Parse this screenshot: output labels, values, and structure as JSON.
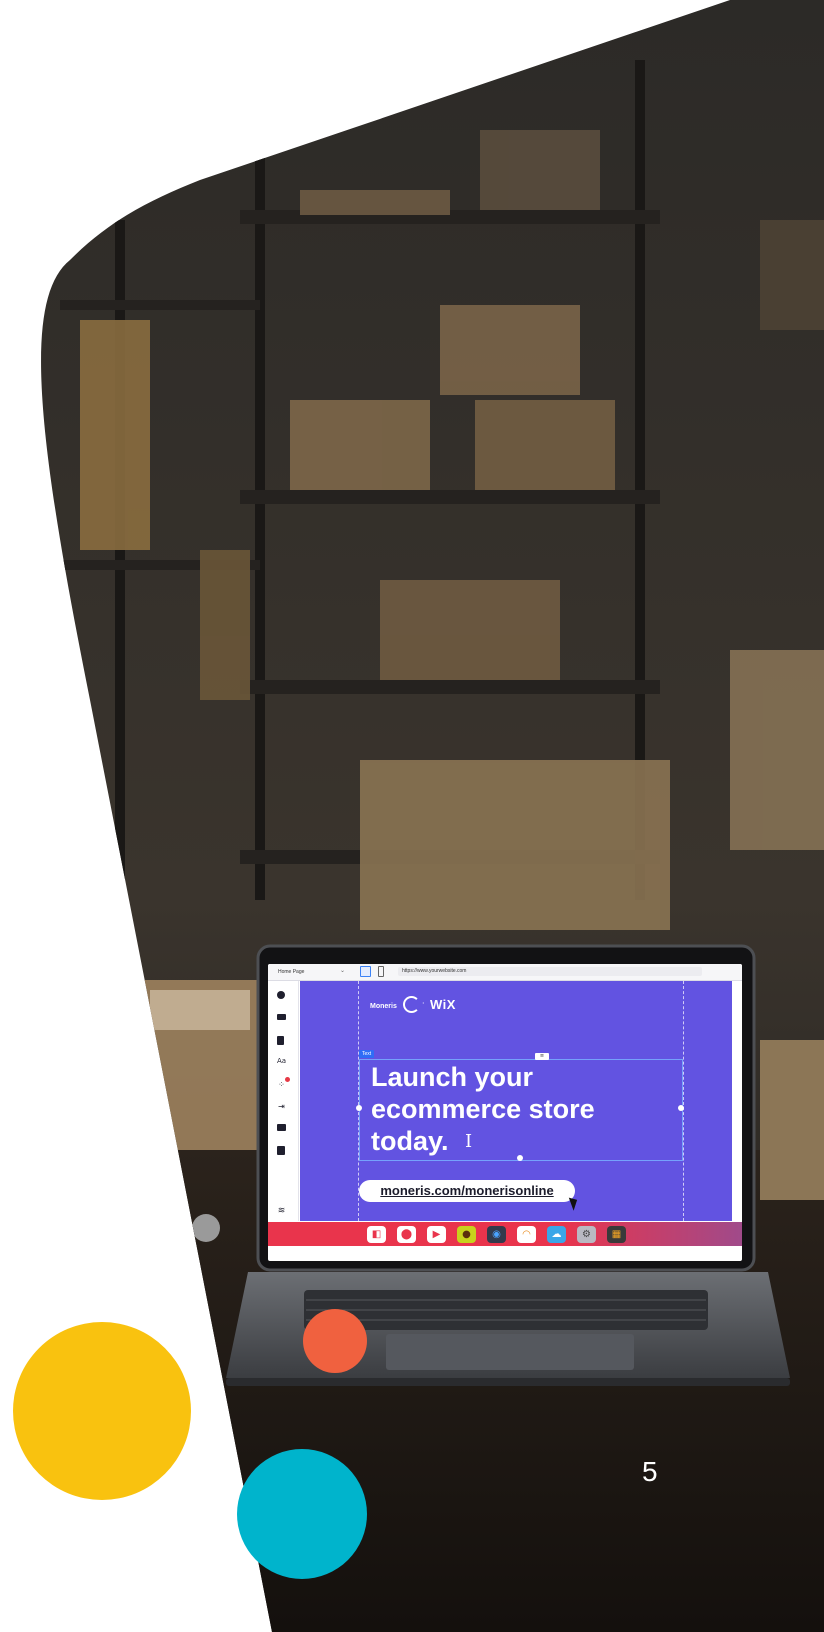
{
  "slide": {
    "page_number": "5",
    "colors": {
      "accent_yellow": "#F9C20F",
      "accent_teal": "#00B4CC",
      "accent_coral": "#F0613F",
      "canvas_purple": "#6253E1",
      "dock_red": "#E9344C"
    }
  },
  "editor": {
    "topbar": {
      "page_select": "Home Page",
      "url": "https://www.yourwebsite.com"
    },
    "sidebar": {
      "tools": [
        "add-icon",
        "sections-icon",
        "pages-icon",
        "theme-icon",
        "apps-icon",
        "business-icon",
        "media-icon",
        "cms-icon",
        "layers-icon"
      ]
    },
    "canvas": {
      "logo_moneris": "Moneris",
      "logo_separator": "·",
      "logo_wix": "WiX",
      "text_tag": "Text",
      "headline": "Launch your ecommerce store today.",
      "cta_url": "moneris.com/monerisonline"
    },
    "dock": {
      "apps": [
        "finder-icon",
        "maps-icon",
        "video-icon",
        "photo-booth-icon",
        "camera-icon",
        "music-icon",
        "weather-icon",
        "settings-icon",
        "calculator-icon"
      ]
    }
  }
}
